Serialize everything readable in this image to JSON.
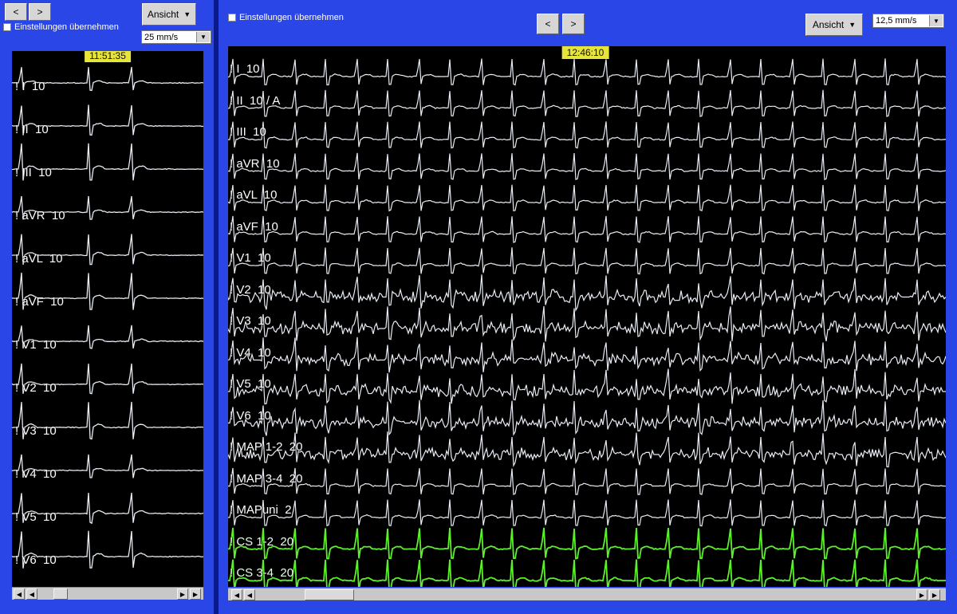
{
  "left": {
    "nav": {
      "prev": "<",
      "next": ">"
    },
    "view_button": {
      "label": "Ansicht"
    },
    "settings_checkbox": {
      "label": "Einstellungen übernehmen",
      "checked": false
    },
    "speed": {
      "value": "25 mm/s"
    },
    "time_badge": "11:51:35",
    "leads": [
      {
        "label": "! I  10"
      },
      {
        "label": "! II  10"
      },
      {
        "label": "! III  10"
      },
      {
        "label": "! aVR  10"
      },
      {
        "label": "! aVL  10"
      },
      {
        "label": "! aVF  10"
      },
      {
        "label": "! V1  10"
      },
      {
        "label": "! V2  10"
      },
      {
        "label": "! V3  10"
      },
      {
        "label": "! V4  10"
      },
      {
        "label": "! V5  10"
      },
      {
        "label": "! V6  10"
      }
    ]
  },
  "right": {
    "nav": {
      "prev": "<",
      "next": ">"
    },
    "view_button": {
      "label": "Ansicht"
    },
    "settings_checkbox": {
      "label": "Einstellungen übernehmen",
      "checked": false
    },
    "speed": {
      "value": "12,5 mm/s"
    },
    "time_badge": "12:46:10",
    "leads": [
      {
        "label": "! I  10"
      },
      {
        "label": "! II  10 / A"
      },
      {
        "label": "! III  10"
      },
      {
        "label": "! aVR  10"
      },
      {
        "label": "! aVL  10"
      },
      {
        "label": "! aVF  10"
      },
      {
        "label": "! V1  10"
      },
      {
        "label": "! V2  10"
      },
      {
        "label": "! V3  10"
      },
      {
        "label": "! V4  10"
      },
      {
        "label": "! V5  10"
      },
      {
        "label": "! V6  10"
      },
      {
        "label": "! MAP 1-2  20"
      },
      {
        "label": "! MAP 3-4  20"
      },
      {
        "label": "! MAPuni  2"
      },
      {
        "label": "! CS 1-2  20"
      },
      {
        "label": "! CS 3-4  20"
      }
    ]
  },
  "colors": {
    "frame": "#2a46e6",
    "trace": "#e8ecf4",
    "cs_trace": "#5df02a",
    "badge": "#e7e43a"
  },
  "icons": {
    "dropdown": "caret-down-icon",
    "scroll_left": "arrow-left-icon",
    "scroll_right": "arrow-right-icon"
  }
}
